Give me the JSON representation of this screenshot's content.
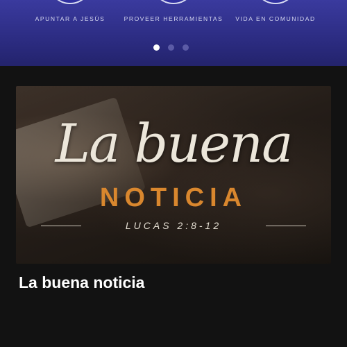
{
  "header": {
    "pillars": [
      {
        "label": "APUNTAR A JESÚS"
      },
      {
        "label": "PROVEER HERRAMIENTAS"
      },
      {
        "label": "VIDA EN COMUNIDAD"
      }
    ],
    "carousel": {
      "total": 3,
      "active_index": 0
    }
  },
  "card": {
    "image": {
      "script_title": "La buena",
      "title_word": "NOTICIA",
      "reference": "LUCAS 2:8-12"
    },
    "title": "La buena noticia"
  },
  "colors": {
    "header_bg": "#2c2c82",
    "accent_orange": "#d9872e",
    "page_bg": "#121212"
  }
}
